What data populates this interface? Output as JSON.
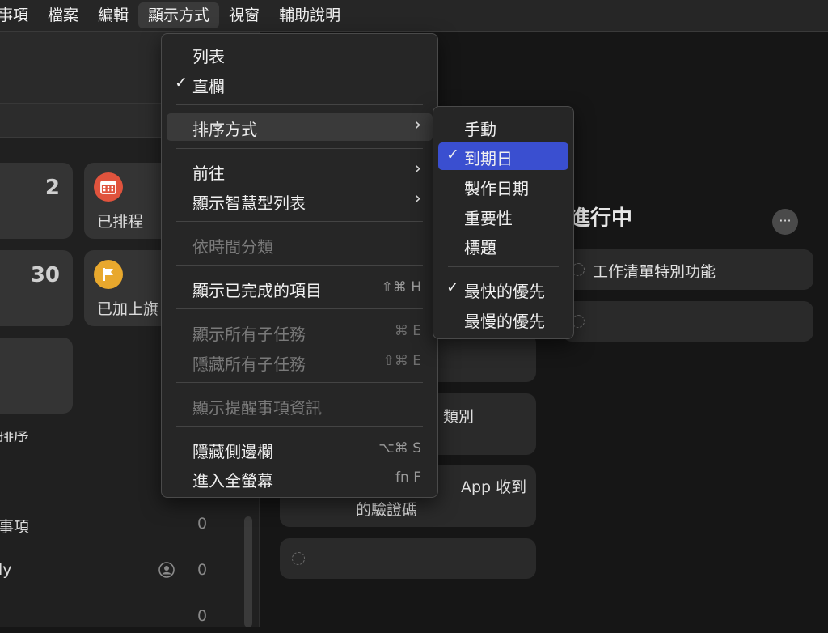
{
  "menubar": {
    "items": [
      "醒事項",
      "檔案",
      "編輯",
      "顯示方式",
      "視窗",
      "輔助說明"
    ],
    "active_index": 3
  },
  "sidebar": {
    "tiles": [
      {
        "count": "2",
        "label": ""
      },
      {
        "count": "",
        "label": "已排程",
        "icon": "calendar-icon",
        "color": "#e0533d"
      },
      {
        "count": "30",
        "label": ""
      },
      {
        "count": "",
        "label": "已加上旗",
        "icon": "flag-icon",
        "color": "#e8a82d"
      }
    ],
    "partial_text": "排序",
    "lists": [
      {
        "name": "事項",
        "count": "0"
      },
      {
        "name": "ly",
        "count": "0",
        "icon": "shared-person-icon"
      },
      {
        "name": "",
        "count": "0"
      }
    ]
  },
  "main": {
    "section_title": "進行中",
    "more_button": "···",
    "right_items": [
      "工作清單特別功能",
      ""
    ],
    "left_items": [
      {
        "text": ""
      },
      {
        "text": "類別"
      },
      {
        "text_line1": "App 收到",
        "text_line2": "的驗證碼"
      },
      {
        "text": ""
      }
    ]
  },
  "view_menu": {
    "items": [
      {
        "label": "列表",
        "checked": false
      },
      {
        "label": "直欄",
        "checked": true,
        "check": "✓"
      },
      {
        "sep": true
      },
      {
        "label": "排序方式",
        "submenu": true,
        "highlighted": true,
        "arrow": "›"
      },
      {
        "sep": true
      },
      {
        "label": "前往",
        "submenu": true,
        "arrow": "›"
      },
      {
        "label": "顯示智慧型列表",
        "submenu": true,
        "arrow": "›"
      },
      {
        "sep": true
      },
      {
        "label": "依時間分類",
        "disabled": true
      },
      {
        "sep": true
      },
      {
        "label": "顯示已完成的項目",
        "shortcut": "⇧⌘ H"
      },
      {
        "sep": true
      },
      {
        "label": "顯示所有子任務",
        "shortcut": "⌘ E",
        "disabled": true
      },
      {
        "label": "隱藏所有子任務",
        "shortcut": "⇧⌘ E",
        "disabled": true
      },
      {
        "sep": true
      },
      {
        "label": "顯示提醒事項資訊",
        "disabled": true
      },
      {
        "sep": true
      },
      {
        "label": "隱藏側邊欄",
        "shortcut": "⌥⌘ S"
      },
      {
        "label": "進入全螢幕",
        "shortcut": "fn F"
      }
    ]
  },
  "sort_menu": {
    "items": [
      {
        "label": "手動"
      },
      {
        "label": "到期日",
        "checked": true,
        "selected": true,
        "check": "✓"
      },
      {
        "label": "製作日期"
      },
      {
        "label": "重要性"
      },
      {
        "label": "標題"
      },
      {
        "sep": true
      },
      {
        "label": "最快的優先",
        "checked": true,
        "check": "✓"
      },
      {
        "label": "最慢的優先"
      }
    ]
  }
}
